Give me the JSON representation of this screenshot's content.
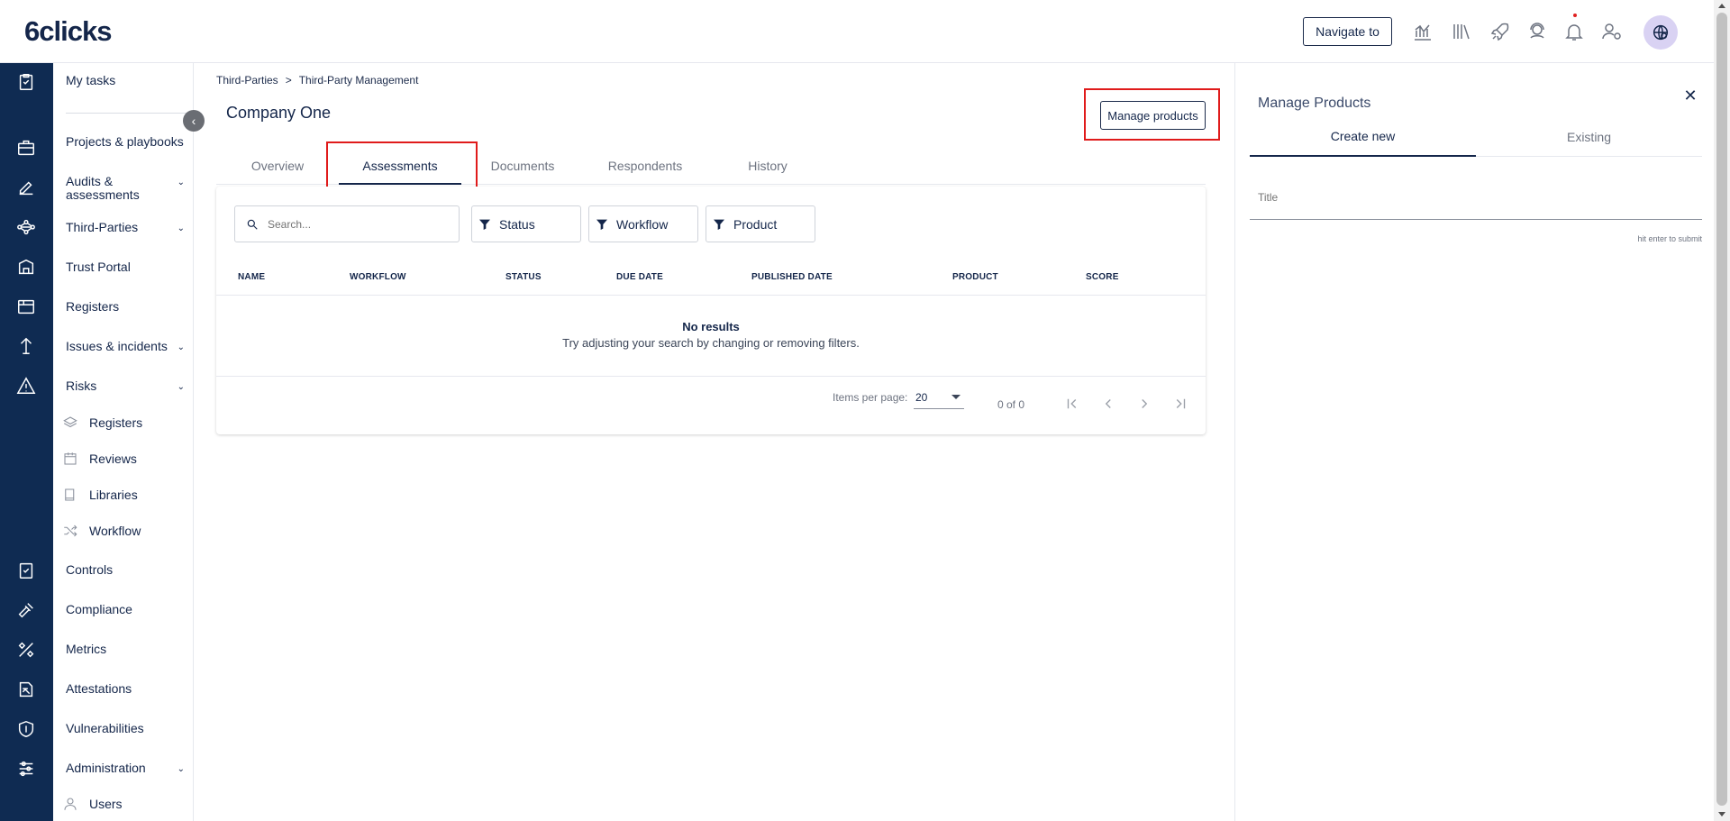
{
  "app": {
    "logo": "6clicks"
  },
  "topbar": {
    "navigate_label": "Navigate to"
  },
  "sidebar": {
    "items": [
      {
        "label": "My tasks"
      },
      {
        "label": "Projects & playbooks"
      },
      {
        "label": "Audits & assessments"
      },
      {
        "label": "Third-Parties"
      },
      {
        "label": "Trust Portal"
      },
      {
        "label": "Registers"
      },
      {
        "label": "Issues & incidents"
      },
      {
        "label": "Risks"
      },
      {
        "label": "Controls"
      },
      {
        "label": "Compliance"
      },
      {
        "label": "Metrics"
      },
      {
        "label": "Attestations"
      },
      {
        "label": "Vulnerabilities"
      },
      {
        "label": "Administration"
      }
    ],
    "risk_subitems": [
      {
        "label": "Registers"
      },
      {
        "label": "Reviews"
      },
      {
        "label": "Libraries"
      },
      {
        "label": "Workflow"
      }
    ],
    "admin_subitems": [
      {
        "label": "Users"
      }
    ]
  },
  "breadcrumb": {
    "parent": "Third-Parties",
    "separator": ">",
    "current": "Third-Party Management"
  },
  "page": {
    "title": "Company One",
    "manage_products_label": "Manage products"
  },
  "tabs": [
    {
      "label": "Overview"
    },
    {
      "label": "Assessments"
    },
    {
      "label": "Documents"
    },
    {
      "label": "Respondents"
    },
    {
      "label": "History"
    }
  ],
  "table": {
    "search_placeholder": "Search...",
    "filters": [
      {
        "label": "Status"
      },
      {
        "label": "Workflow"
      },
      {
        "label": "Product"
      }
    ],
    "columns": [
      "NAME",
      "WORKFLOW",
      "STATUS",
      "DUE DATE",
      "PUBLISHED DATE",
      "PRODUCT",
      "SCORE"
    ],
    "empty_title": "No results",
    "empty_text": "Try adjusting your search by changing or removing filters.",
    "items_per_page_label": "Items per page:",
    "items_per_page_value": "20",
    "range_label": "0 of 0"
  },
  "drawer": {
    "title": "Manage Products",
    "tabs": [
      {
        "label": "Create new"
      },
      {
        "label": "Existing"
      }
    ],
    "title_placeholder": "Title",
    "hint": "hit enter to submit"
  },
  "colors": {
    "brand": "#0f2b52",
    "highlight": "#e01b1b",
    "avatar_bg": "#d9d2f3"
  }
}
